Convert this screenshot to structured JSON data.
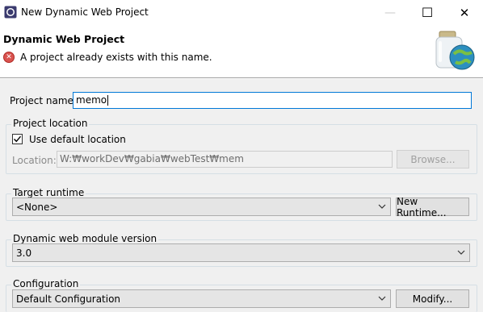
{
  "window": {
    "title": "New Dynamic Web Project",
    "minimize_glyph": "—",
    "maximize_glyph": "☐",
    "close_glyph": "✕"
  },
  "header": {
    "title": "Dynamic Web Project",
    "error_glyph": "✕",
    "error_message": "A project already exists with this name."
  },
  "project_name": {
    "label": "Project name:",
    "value": "memo"
  },
  "project_location": {
    "group_label": "Project location",
    "use_default_label": "Use default location",
    "use_default_checked": true,
    "location_label": "Location:",
    "location_value": "W:₩workDev₩gabia₩webTest₩mem",
    "browse_label": "Browse..."
  },
  "target_runtime": {
    "group_label": "Target runtime",
    "selected": "<None>",
    "new_runtime_label": "New Runtime..."
  },
  "module_version": {
    "group_label": "Dynamic web module version",
    "selected": "3.0"
  },
  "configuration": {
    "group_label": "Configuration",
    "selected": "Default Configuration",
    "modify_label": "Modify..."
  },
  "colors": {
    "focus_border": "#0078d7",
    "error_red": "#d9534f",
    "dialog_bg": "#f0f0f0"
  }
}
